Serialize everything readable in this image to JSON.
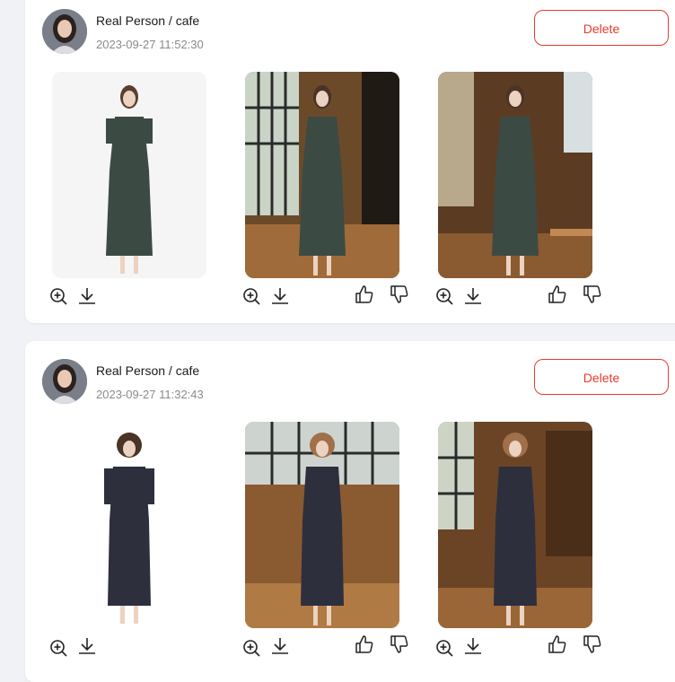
{
  "posts": [
    {
      "title": "Real Person / cafe",
      "timestamp": "2023-09-27 11:52:30",
      "delete_label": "Delete",
      "dress_color": "#3c4a44",
      "photos": [
        {
          "scene": "studio",
          "actions": [
            "zoom-in-icon",
            "download-icon"
          ]
        },
        {
          "scene": "cafe-window",
          "actions": [
            "zoom-in-icon",
            "download-icon",
            "thumbs-up-icon",
            "thumbs-down-icon"
          ]
        },
        {
          "scene": "cafe-interior",
          "actions": [
            "zoom-in-icon",
            "download-icon",
            "thumbs-up-icon",
            "thumbs-down-icon"
          ]
        }
      ]
    },
    {
      "title": "Real Person / cafe",
      "timestamp": "2023-09-27 11:32:43",
      "delete_label": "Delete",
      "dress_color": "#2d2f3d",
      "photos": [
        {
          "scene": "studio",
          "actions": [
            "zoom-in-icon",
            "download-icon"
          ]
        },
        {
          "scene": "cafe-window",
          "actions": [
            "zoom-in-icon",
            "download-icon",
            "thumbs-up-icon",
            "thumbs-down-icon"
          ]
        },
        {
          "scene": "cafe-interior",
          "actions": [
            "zoom-in-icon",
            "download-icon",
            "thumbs-up-icon",
            "thumbs-down-icon"
          ]
        }
      ]
    }
  ],
  "colors": {
    "page_bg": "#f1f2f6",
    "card_bg": "#ffffff",
    "delete_accent": "#e8392c",
    "meta_text": "#8a8a8a"
  }
}
